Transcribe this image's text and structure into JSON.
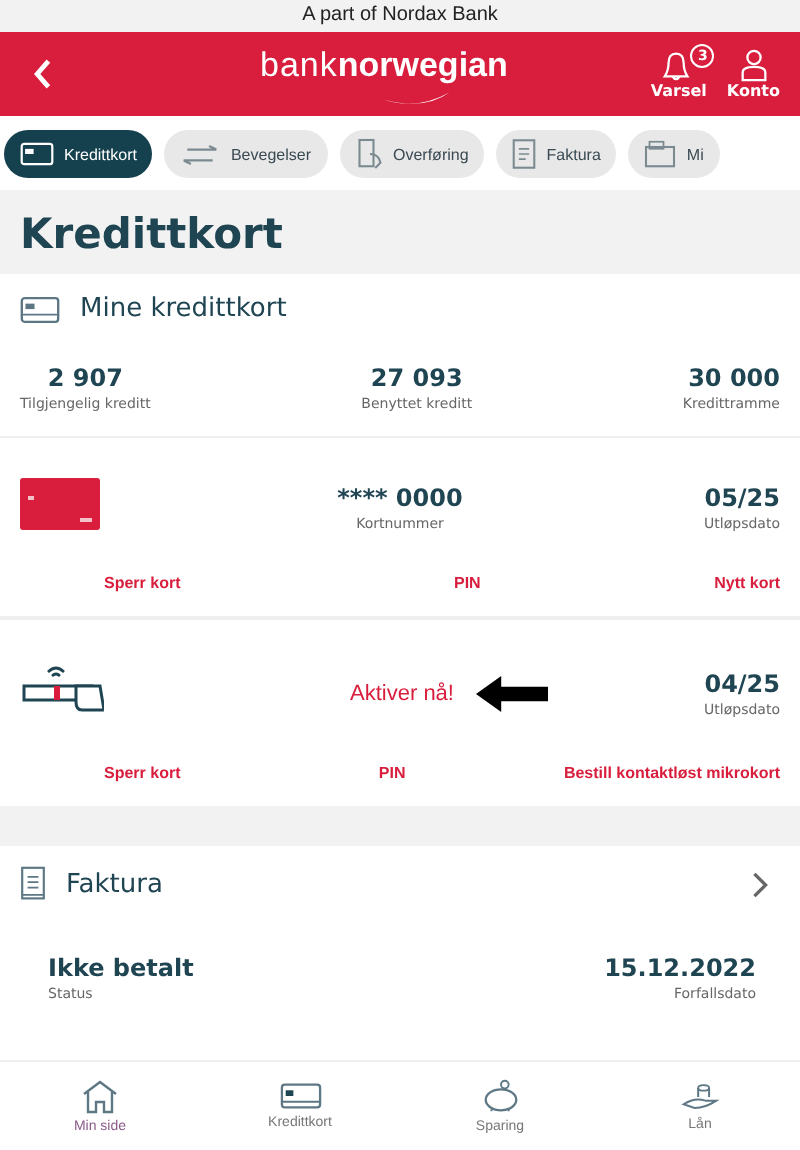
{
  "top_banner": "A part of Nordax Bank",
  "header": {
    "logo_left": "bank",
    "logo_right": "norwegian",
    "notification_count": "3",
    "actions": [
      {
        "label": "Varsel",
        "kind": "bell"
      },
      {
        "label": "Konto",
        "kind": "person"
      }
    ]
  },
  "tabs": [
    {
      "label": "Kredittkort",
      "kind": "card",
      "selected": true
    },
    {
      "label": "Bevegelser",
      "kind": "arrows",
      "selected": false
    },
    {
      "label": "Overføring",
      "kind": "transfer",
      "selected": false
    },
    {
      "label": "Faktura",
      "kind": "invoice",
      "selected": false
    },
    {
      "label": "Mi",
      "kind": "wallet",
      "selected": false
    }
  ],
  "page_title": "Kredittkort",
  "cards_section": {
    "title": "Mine kredittkort",
    "summary": [
      {
        "value": "2 907",
        "label": "Tilgjengelig kreditt"
      },
      {
        "value": "27 093",
        "label": "Benyttet kreditt"
      },
      {
        "value": "30 000",
        "label": "Kredittramme"
      }
    ],
    "cards": [
      {
        "kind": "card",
        "middle_value": "**** 0000",
        "middle_label": "Kortnummer",
        "expiry": "05/25",
        "expiry_label": "Utløpsdato",
        "actions": [
          "Sperr kort",
          "PIN",
          "Nytt kort"
        ]
      },
      {
        "kind": "microcard",
        "middle_link": "Aktiver nå!",
        "expiry": "04/25",
        "expiry_label": "Utløpsdato",
        "actions": [
          "Sperr kort",
          "PIN",
          "Bestill kontaktløst mikrokort"
        ]
      }
    ]
  },
  "invoice_section": {
    "title": "Faktura",
    "status_value": "Ikke betalt",
    "status_label": "Status",
    "due_value": "15.12.2022",
    "due_label": "Forfallsdato"
  },
  "bottom_nav": [
    {
      "label": "Min side",
      "kind": "home",
      "selected": true
    },
    {
      "label": "Kredittkort",
      "kind": "card",
      "selected": false
    },
    {
      "label": "Sparing",
      "kind": "piggy",
      "selected": false
    },
    {
      "label": "Lån",
      "kind": "loan",
      "selected": false
    }
  ]
}
